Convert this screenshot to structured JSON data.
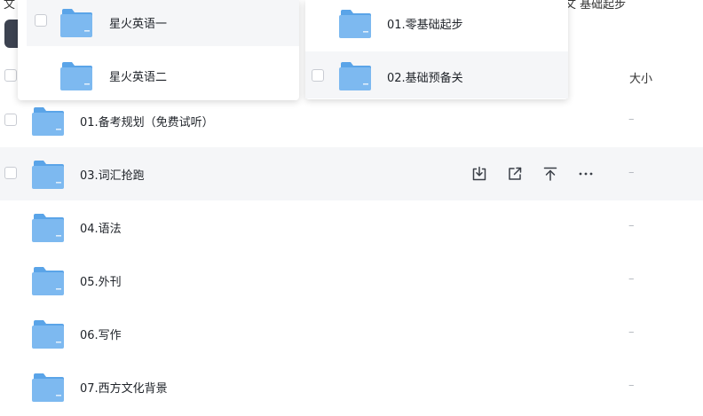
{
  "top": {
    "left_glyph": "文",
    "right_glyph": "文 基础起步"
  },
  "table": {
    "header": {
      "size_label": "大小"
    },
    "rows": [
      {
        "name": "01.备考规划（免费试听）",
        "size": "–",
        "hovered": false
      },
      {
        "name": "03.词汇抢跑",
        "size": "–",
        "hovered": true
      },
      {
        "name": "04.语法",
        "size": "–",
        "hovered": false
      },
      {
        "name": "05.外刊",
        "size": "–",
        "hovered": false
      },
      {
        "name": "06.写作",
        "size": "–",
        "hovered": false
      },
      {
        "name": "07.西方文化背景",
        "size": "–",
        "hovered": false
      }
    ],
    "row_actions": [
      {
        "icon": "download-icon"
      },
      {
        "icon": "share-icon"
      },
      {
        "icon": "move-to-top-icon"
      },
      {
        "icon": "more-icon"
      }
    ]
  },
  "dropdowns": {
    "left": {
      "items": [
        {
          "label": "星火英语一",
          "highlighted": true
        },
        {
          "label": "星火英语二",
          "highlighted": false
        }
      ]
    },
    "right": {
      "items": [
        {
          "label": "01.零基础起步",
          "highlighted": false
        },
        {
          "label": "02.基础预备关",
          "highlighted": true
        }
      ]
    }
  },
  "colors": {
    "folder_body": "#7db9f0",
    "folder_tab": "#5aa4e8",
    "hover_row": "#f5f6f8",
    "text_primary": "#1f2329",
    "text_muted": "#b4b8bf",
    "icon_color": "#3a3f47",
    "dark_button": "#3c4250"
  }
}
